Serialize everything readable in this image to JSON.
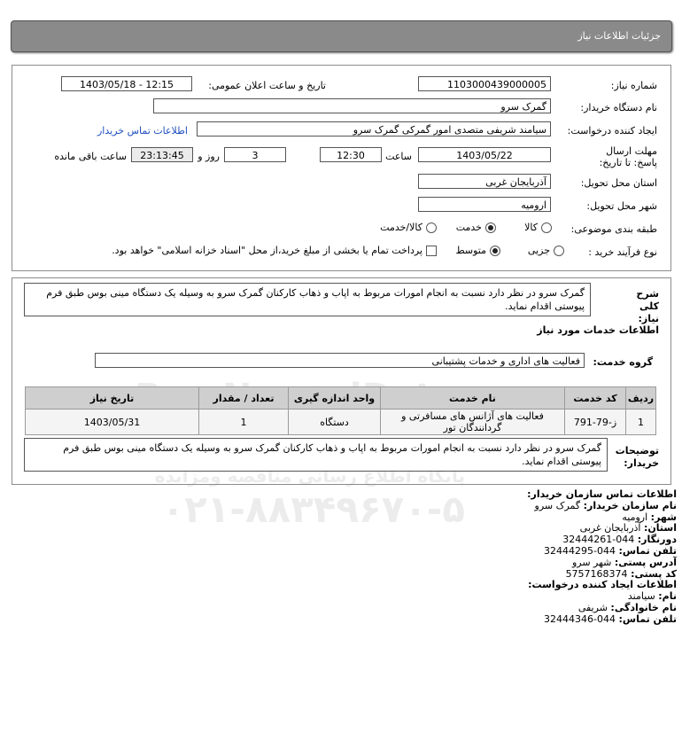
{
  "header": {
    "title": "جزئیات اطلاعات نیاز"
  },
  "form": {
    "need_number_label": "شماره نیاز:",
    "need_number": "1103000439000005",
    "announce_label": "تاریخ و ساعت اعلان عمومی:",
    "announce_value": "1403/05/18 - 12:15",
    "buyer_label": "نام دستگاه خریدار:",
    "buyer_value": "گمرک سرو",
    "creator_label": "ایجاد کننده درخواست:",
    "creator_value": "سیامند شریفی متصدی امور گمرکی گمرک سرو",
    "contact_link": "اطلاعات تماس خریدار",
    "deadline_label": "مهلت ارسال پاسخ: تا تاریخ:",
    "deadline_date": "1403/05/22",
    "time_label": "ساعت",
    "deadline_time": "12:30",
    "days_value": "3",
    "days_label": "روز و",
    "remaining_value": "23:13:45",
    "remaining_label": "ساعت باقی مانده",
    "province_label": "استان محل تحویل:",
    "province_value": "آذربایجان غربی",
    "city_label": "شهر محل تحویل:",
    "city_value": "ارومیه",
    "category_label": "طبقه بندی موضوعی:",
    "category_options": [
      "کالا",
      "خدمت",
      "کالا/خدمت"
    ],
    "category_selected": "خدمت",
    "process_label": "نوع فرآیند خرید :",
    "process_options": [
      "جزیی",
      "متوسط"
    ],
    "process_selected": "متوسط",
    "payment_note": "پرداخت تمام یا بخشی از مبلغ خرید،از محل \"اسناد خزانه اسلامی\" خواهد بود."
  },
  "description": {
    "label": "شرح کلی نیاز:",
    "text": "گمرک سرو در نظر دارد نسبت به انجام امورات مربوط به اپاب و ذهاب کارکنان گمرک سرو به وسیله یک دستگاه مینی بوس طبق فرم پیوستی اقدام نماید."
  },
  "services": {
    "title": "اطلاعات خدمات مورد نیاز",
    "group_label": "گروه خدمت:",
    "group_value": "فعالیت های اداری و خدمات پشتیبانی"
  },
  "table": {
    "headers": [
      "ردیف",
      "کد خدمت",
      "نام خدمت",
      "واحد اندازه گیری",
      "تعداد / مقدار",
      "تاریخ نیاز"
    ],
    "rows": [
      [
        "1",
        "ز-79-791",
        "فعالیت های آژانس های مسافرتی و گردانندگان تور",
        "دستگاه",
        "1",
        "1403/05/31"
      ]
    ]
  },
  "buyer_notes": {
    "label": "توضیحات خریدار:",
    "text": "گمرک سرو در نظر دارد نسبت به انجام امورات مربوط به اپاب و ذهاب کارکنان گمرک سرو به وسیله یک دستگاه مینی بوس طبق فرم پیوستی اقدام نماید."
  },
  "contact": {
    "org_title": "اطلاعات تماس سازمان خریدار:",
    "org_name_label": "نام سازمان خریدار:",
    "org_name": "گمرک سرو",
    "city_label": "شهر:",
    "city": "ارومیه",
    "province_label": "استان:",
    "province": "آذربایجان غربی",
    "fax_label": "دورنگار:",
    "fax": "044-32444261",
    "phone_label": "تلفن تماس:",
    "phone": "044-32444295",
    "address_label": "آدرس پستی:",
    "address": "شهر سرو",
    "postal_label": "کد پستی:",
    "postal": "5757168374",
    "creator_title": "اطلاعات ایجاد کننده درخواست:",
    "first_name_label": "نام:",
    "first_name": "سیامند",
    "last_name_label": "نام خانوادگی:",
    "last_name": "شریفی",
    "creator_phone_label": "تلفن تماس:",
    "creator_phone": "044-32444346"
  },
  "watermark": {
    "brand": "ParsNamadData",
    "tagline": "پایگاه اطلاع رسانی مناقصه ومزایده",
    "phone": "۰۲۱-۸۸۳۴۹۶۷۰-۵"
  }
}
